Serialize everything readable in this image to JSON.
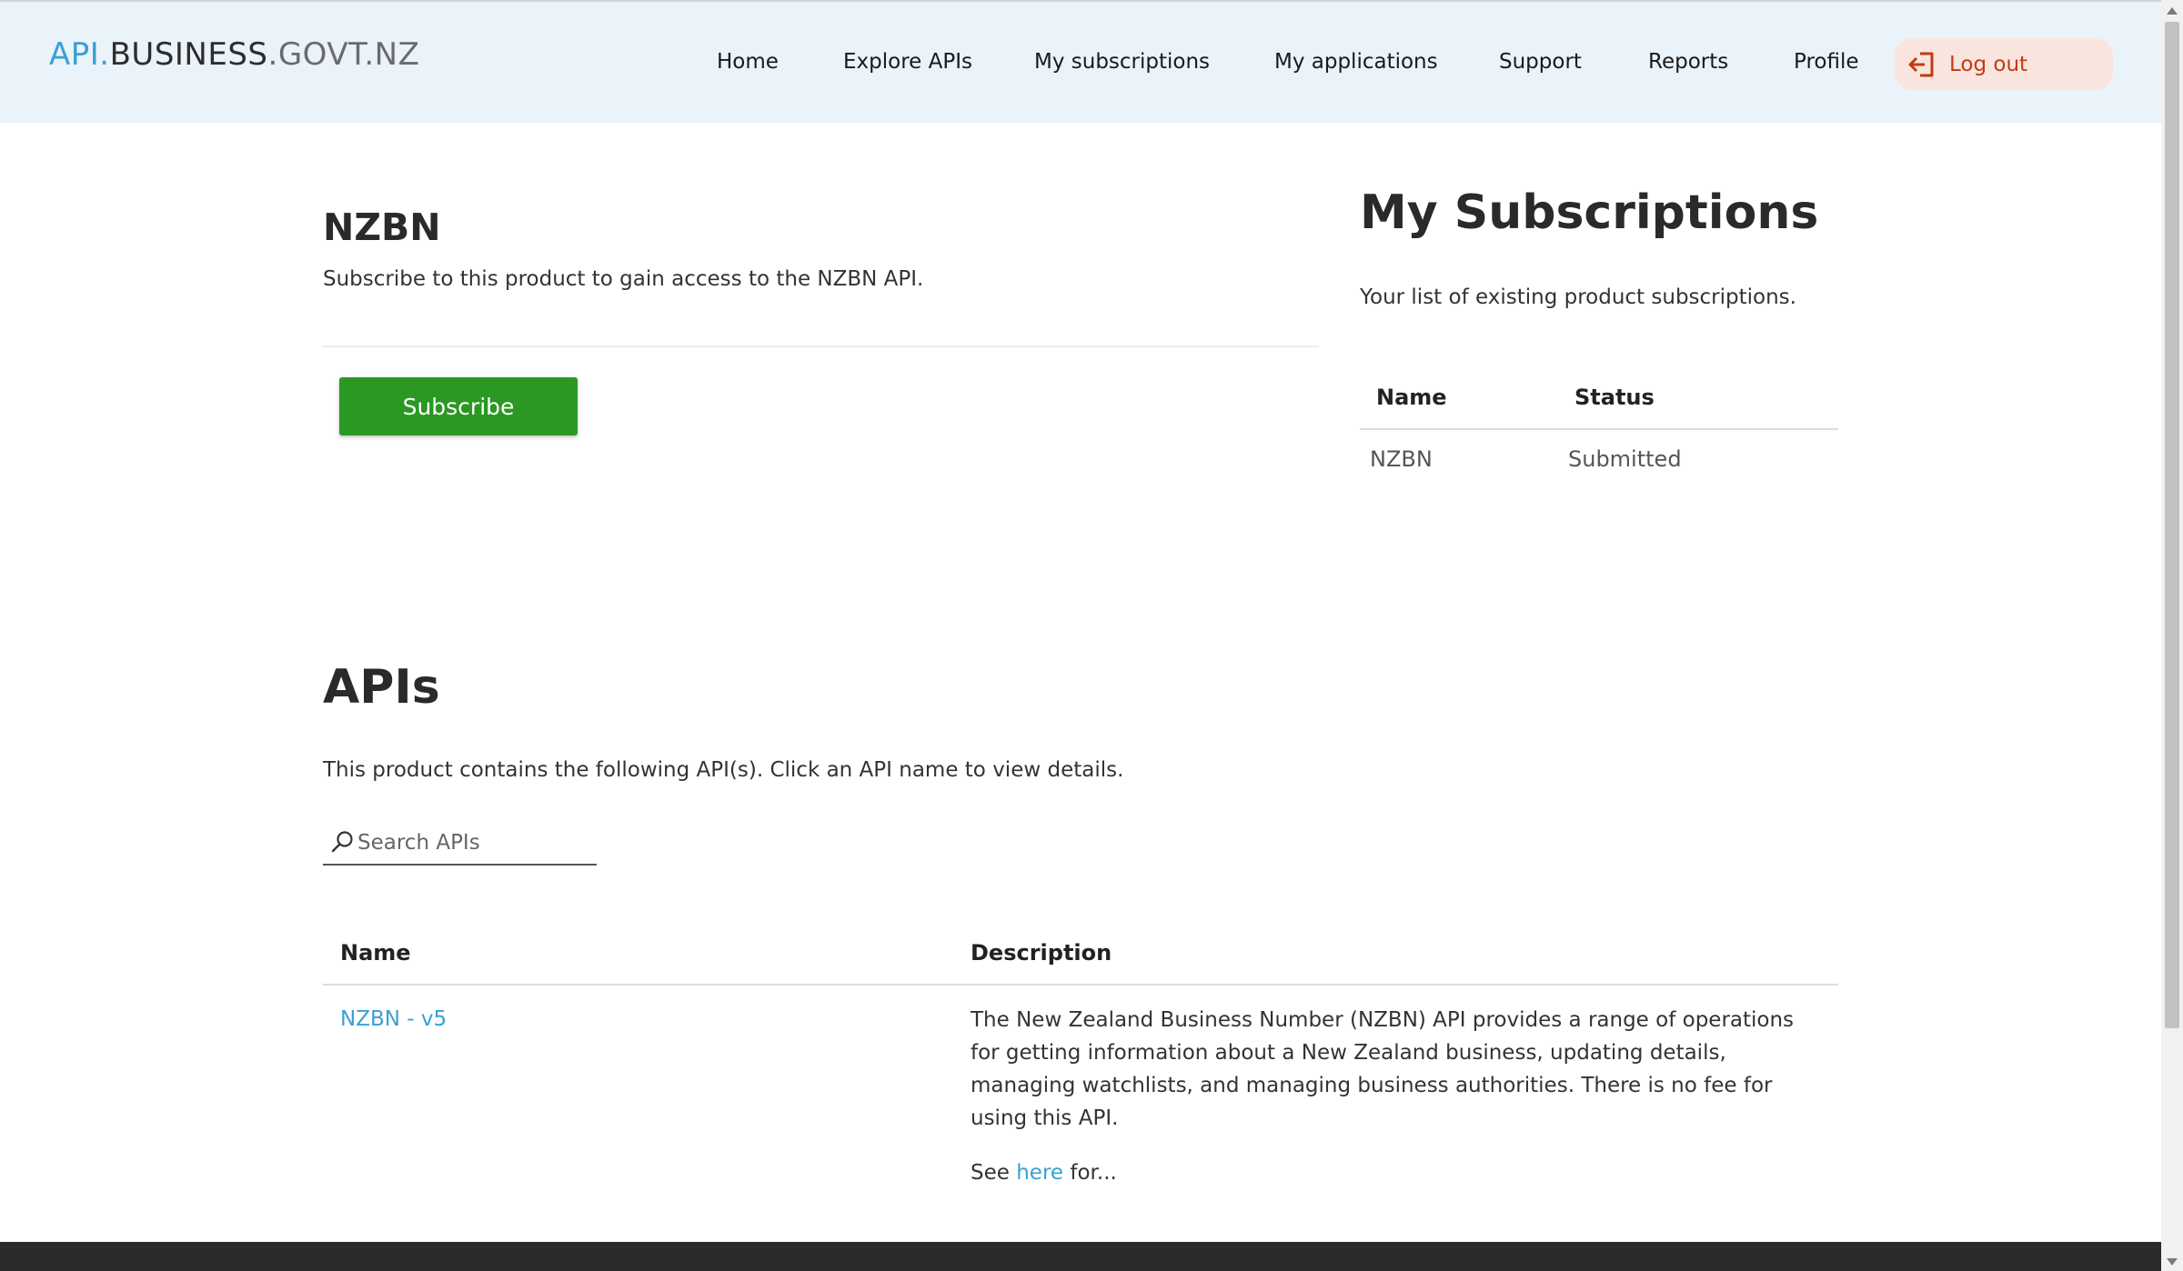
{
  "logo": {
    "part1": "API.",
    "part2": "BUSINESS",
    "part3": ".GOVT.NZ"
  },
  "nav": {
    "items": [
      "Home",
      "Explore APIs",
      "My subscriptions",
      "My applications",
      "Support",
      "Reports",
      "Profile"
    ],
    "logout": "Log out"
  },
  "product": {
    "title": "NZBN",
    "description": "Subscribe to this product to gain access to the NZBN API.",
    "subscribe_label": "Subscribe"
  },
  "subscriptions": {
    "title": "My Subscriptions",
    "description": "Your list of existing product subscriptions.",
    "columns": [
      "Name",
      "Status"
    ],
    "rows": [
      {
        "name": "NZBN",
        "status": "Submitted"
      }
    ]
  },
  "apis": {
    "title": "APIs",
    "description": "This product contains the following API(s). Click an API name to view details.",
    "search_placeholder": "Search APIs",
    "columns": [
      "Name",
      "Description"
    ],
    "rows": [
      {
        "name": "NZBN - v5",
        "description": "The New Zealand Business Number (NZBN) API provides a range of operations for getting information about a New Zealand business, updating details, managing watchlists, and managing business authorities. There is no fee for using this API.",
        "see_prefix": "See ",
        "see_link": "here",
        "see_suffix": " for..."
      }
    ]
  },
  "colors": {
    "accent": "#3aa0d4",
    "subscribe": "#2a9823",
    "logout": "#c13b14",
    "header_bg": "#eaf2fa"
  }
}
